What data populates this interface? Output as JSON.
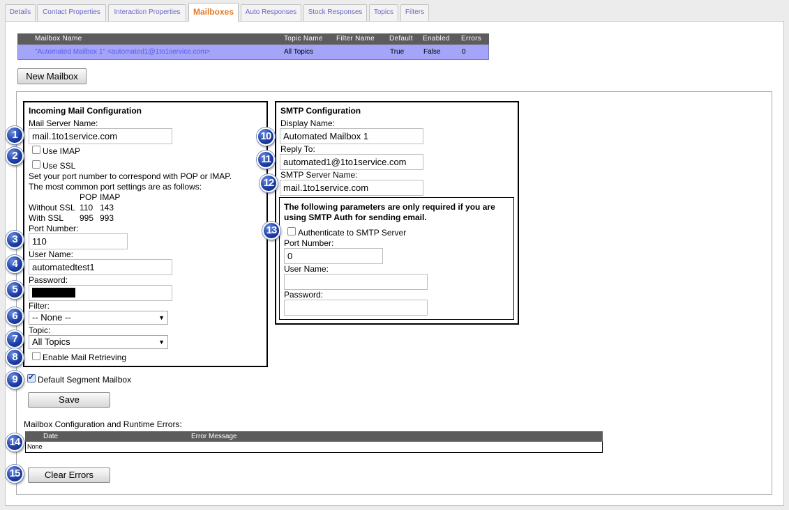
{
  "tabs": [
    "Details",
    "Contact Properties",
    "Interaction Properties",
    "Mailboxes",
    "Auto Responses",
    "Stock Responses",
    "Topics",
    "Filters"
  ],
  "active_tab": "Mailboxes",
  "mailbox_table": {
    "headers": [
      "Mailbox Name",
      "Topic Name",
      "Filter Name",
      "Default",
      "Enabled",
      "Errors"
    ],
    "rows": [
      {
        "name": "\"Automated Mailbox 1\" <automated1@1to1service.com>",
        "topic": "All Topics",
        "filter": "",
        "default": "True",
        "enabled": "False",
        "errors": "0"
      }
    ]
  },
  "new_mailbox_label": "New Mailbox",
  "incoming": {
    "title": "Incoming Mail Configuration",
    "server_label": "Mail Server Name:",
    "server_value": "mail.1to1service.com",
    "use_imap_label": "Use IMAP",
    "use_imap_checked": false,
    "use_ssl_label": "Use SSL",
    "use_ssl_checked": false,
    "port_help_1": "Set your port number to correspond with POP or IMAP.",
    "port_help_2": "The most common port settings are as follows:",
    "port_table": {
      "col_pop": "POP",
      "col_imap": "IMAP",
      "rows": [
        {
          "label": "Without SSL",
          "pop": "110",
          "imap": "143"
        },
        {
          "label": "With SSL",
          "pop": "995",
          "imap": "993"
        }
      ]
    },
    "port_label": "Port Number:",
    "port_value": "110",
    "user_label": "User Name:",
    "user_value": "automatedtest1",
    "password_label": "Password:",
    "filter_label": "Filter:",
    "filter_value": "-- None --",
    "topic_label": "Topic:",
    "topic_value": "All Topics",
    "enable_label": "Enable Mail Retrieving",
    "enable_checked": false
  },
  "smtp": {
    "title": "SMTP Configuration",
    "display_label": "Display Name:",
    "display_value": "Automated Mailbox 1",
    "reply_label": "Reply To:",
    "reply_value": "automated1@1to1service.com",
    "server_label": "SMTP Server Name:",
    "server_value": "mail.1to1service.com",
    "auth_note_1": "The following parameters are only required if you are",
    "auth_note_2": "using SMTP Auth for sending email.",
    "auth_label": "Authenticate to SMTP Server",
    "auth_checked": false,
    "port_label": "Port Number:",
    "port_value": "0",
    "user_label": "User Name:",
    "user_value": "",
    "password_label": "Password:",
    "password_value": ""
  },
  "default_segment_label": "Default Segment Mailbox",
  "default_segment_checked": true,
  "save_label": "Save",
  "errors": {
    "title": "Mailbox Configuration and Runtime Errors:",
    "headers": [
      "Date",
      "Error Message"
    ],
    "empty_text": "None"
  },
  "clear_errors_label": "Clear Errors",
  "badges": [
    "1",
    "2",
    "3",
    "4",
    "5",
    "6",
    "7",
    "8",
    "9",
    "10",
    "11",
    "12",
    "13",
    "14",
    "15"
  ],
  "colors": {
    "tab_link": "#6b66c9",
    "tab_active": "#e07a2a",
    "selected_row": "#a4a4f8",
    "badge": "#1c3fa8"
  }
}
